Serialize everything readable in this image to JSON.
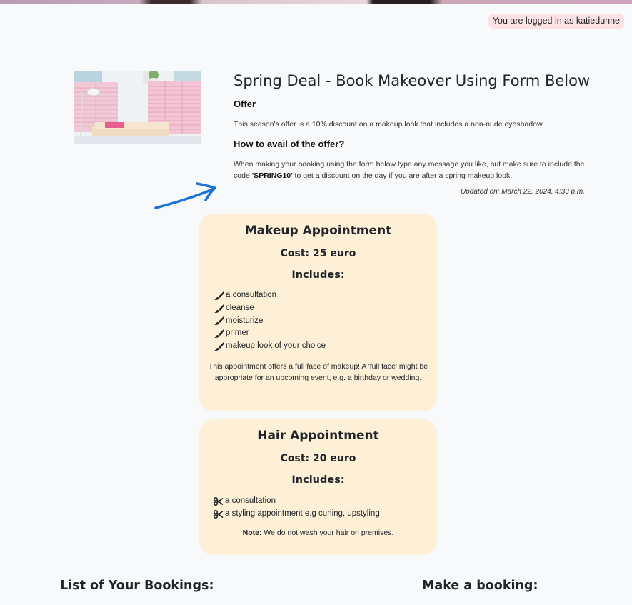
{
  "header": {
    "login_status": "You are logged in as katiedunne"
  },
  "offer": {
    "image_alt": "salon room with pink shutters",
    "title": "Spring Deal - Book Makeover Using Form Below",
    "offer_heading": "Offer",
    "offer_text": "This season's offer is a 10% discount on a makeup look that includes a non-nude eyeshadow.",
    "how_heading": "How to avail of the offer?",
    "how_text_before": "When making your booking using the form below type any message you like, but make sure to include the code ",
    "code": "'SPRING10'",
    "how_text_after": " to get a discount on the day if you are after a spring makeup look.",
    "updated": "Updated on: March 22, 2024, 4:33 p.m."
  },
  "makeup_card": {
    "title": "Makeup Appointment",
    "cost": "Cost: 25 euro",
    "includes_label": "Includes:",
    "items": [
      "a consultation",
      "cleanse",
      "moisturize",
      "primer",
      "makeup look of your choice"
    ],
    "item_icon": "brush-icon",
    "description": "This appointment offers a full face of makeup! A 'full face' might be appropriate for an upcoming event, e.g. a birthday or wedding."
  },
  "hair_card": {
    "title": "Hair Appointment",
    "cost": "Cost: 20 euro",
    "includes_label": "Includes:",
    "items": [
      "a consultation",
      "a styling appointment e.g curling, upstyling"
    ],
    "item_icon": "scissors-icon",
    "note_label": "Note:",
    "note_text": " We do not wash your hair on premises."
  },
  "sections": {
    "bookings_title": "List of Your Bookings:",
    "make_booking_title": "Make a booking:"
  },
  "colors": {
    "card_bg": "#fdf0d7",
    "badge_bg": "#fbe3e5",
    "annotation_arrow": "#1a73d9",
    "page_bg": "#f8f9fb"
  }
}
